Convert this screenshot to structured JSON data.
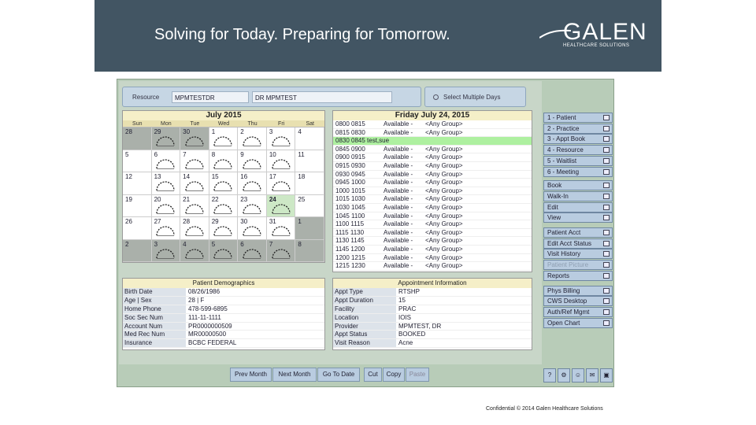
{
  "header": {
    "tagline": "Solving for Today. Preparing for Tomorrow.",
    "logo_word": "GALEN",
    "logo_sub": "HEALTHCARE SOLUTIONS"
  },
  "resource_bar": {
    "label": "Resource",
    "id_value": "MPMTESTDR",
    "name_value": "DR MPMTEST",
    "multi_days_label": "Select Multiple Days"
  },
  "calendar": {
    "title": "July 2015",
    "weekdays": [
      "Sun",
      "Mon",
      "Tue",
      "Wed",
      "Thu",
      "Fri",
      "Sat"
    ],
    "weeks": [
      [
        "28",
        "29",
        "30",
        "1",
        "2",
        "3",
        "4"
      ],
      [
        "5",
        "6",
        "7",
        "8",
        "9",
        "10",
        "11"
      ],
      [
        "12",
        "13",
        "14",
        "15",
        "16",
        "17",
        "18"
      ],
      [
        "19",
        "20",
        "21",
        "22",
        "23",
        "24",
        "25"
      ],
      [
        "26",
        "27",
        "28",
        "29",
        "30",
        "31",
        "1"
      ],
      [
        "2",
        "3",
        "4",
        "5",
        "6",
        "7",
        "8"
      ]
    ],
    "selected_day": "24"
  },
  "slots": {
    "title": "Friday July 24, 2015",
    "rows": [
      {
        "time": "0800 0815",
        "status": "Available -",
        "group": "<Any Group>",
        "selected": false
      },
      {
        "time": "0815 0830",
        "status": "Available -",
        "group": "<Any Group>",
        "selected": false
      },
      {
        "time": "0830 0845 test,sue",
        "status": "",
        "group": "",
        "selected": true
      },
      {
        "time": "0845 0900",
        "status": "Available -",
        "group": "<Any Group>",
        "selected": false
      },
      {
        "time": "0900 0915",
        "status": "Available -",
        "group": "<Any Group>",
        "selected": false
      },
      {
        "time": "0915 0930",
        "status": "Available -",
        "group": "<Any Group>",
        "selected": false
      },
      {
        "time": "0930 0945",
        "status": "Available -",
        "group": "<Any Group>",
        "selected": false
      },
      {
        "time": "0945 1000",
        "status": "Available -",
        "group": "<Any Group>",
        "selected": false
      },
      {
        "time": "1000 1015",
        "status": "Available -",
        "group": "<Any Group>",
        "selected": false
      },
      {
        "time": "1015 1030",
        "status": "Available -",
        "group": "<Any Group>",
        "selected": false
      },
      {
        "time": "1030 1045",
        "status": "Available -",
        "group": "<Any Group>",
        "selected": false
      },
      {
        "time": "1045 1100",
        "status": "Available -",
        "group": "<Any Group>",
        "selected": false
      },
      {
        "time": "1100 1115",
        "status": "Available -",
        "group": "<Any Group>",
        "selected": false
      },
      {
        "time": "1115 1130",
        "status": "Available -",
        "group": "<Any Group>",
        "selected": false
      },
      {
        "time": "1130 1145",
        "status": "Available -",
        "group": "<Any Group>",
        "selected": false
      },
      {
        "time": "1145 1200",
        "status": "Available -",
        "group": "<Any Group>",
        "selected": false
      },
      {
        "time": "1200 1215",
        "status": "Available -",
        "group": "<Any Group>",
        "selected": false
      },
      {
        "time": "1215 1230",
        "status": "Available -",
        "group": "<Any Group>",
        "selected": false
      }
    ]
  },
  "demographics": {
    "title": "Patient Demographics",
    "rows": [
      {
        "label": "Birth Date",
        "value": "08/26/1986"
      },
      {
        "label": "Age | Sex",
        "value": "28 | F"
      },
      {
        "label": "Home Phone",
        "value": "478-599-6895"
      },
      {
        "label": "Soc Sec Num",
        "value": "111-11-1111"
      },
      {
        "label": "Account Num",
        "value": "PR0000000509"
      },
      {
        "label": "Med Rec Num",
        "value": "MR00000500"
      },
      {
        "label": "Insurance",
        "value": "BCBC FEDERAL"
      }
    ]
  },
  "appointment": {
    "title": "Appointment Information",
    "rows": [
      {
        "label": "Appt Type",
        "value": "RTSHP"
      },
      {
        "label": "Appt Duration",
        "value": "15"
      },
      {
        "label": "Facility",
        "value": "PRAC"
      },
      {
        "label": "Location",
        "value": "IOIS"
      },
      {
        "label": "Provider",
        "value": "MPMTEST, DR"
      },
      {
        "label": "Appt Status",
        "value": "BOOKED"
      },
      {
        "label": "Visit Reason",
        "value": "Acne"
      }
    ]
  },
  "toolbar": {
    "prev_month": "Prev Month",
    "next_month": "Next Month",
    "go_to_date": "Go To Date",
    "cut": "Cut",
    "copy": "Copy",
    "paste": "Paste"
  },
  "nav": {
    "tabs": [
      {
        "label": "1 - Patient",
        "icon": "patient-icon"
      },
      {
        "label": "2 - Practice",
        "icon": "practice-icon"
      },
      {
        "label": "3 - Appt Book",
        "icon": "book-icon"
      },
      {
        "label": "4 - Resource",
        "icon": "resource-icon"
      },
      {
        "label": "5 - Waitlist",
        "icon": "waitlist-icon"
      },
      {
        "label": "6 - Meeting",
        "icon": "meeting-icon"
      }
    ],
    "appt_actions": [
      {
        "label": "Book",
        "icon": "book-icon"
      },
      {
        "label": "Walk-In",
        "icon": "walk-in-icon"
      },
      {
        "label": "Edit",
        "icon": "edit-icon"
      },
      {
        "label": "View",
        "icon": "view-icon"
      }
    ],
    "patient_actions": [
      {
        "label": "Patient Acct",
        "icon": "account-icon",
        "enabled": true
      },
      {
        "label": "Edit Acct Status",
        "icon": "status-icon",
        "enabled": true
      },
      {
        "label": "Visit History",
        "icon": "history-icon",
        "enabled": true
      },
      {
        "label": "Patient Picture",
        "icon": "picture-icon",
        "enabled": false
      },
      {
        "label": "Reports",
        "icon": "reports-icon",
        "enabled": true
      }
    ],
    "billing_actions": [
      {
        "label": "Phys Billing",
        "icon": "billing-icon"
      },
      {
        "label": "CWS Desktop",
        "icon": "desktop-icon"
      },
      {
        "label": "Auth/Ref Mgmt",
        "icon": "auth-icon"
      },
      {
        "label": "Open Chart",
        "icon": "chart-icon"
      }
    ],
    "bottom_buttons": [
      "?",
      "⚙",
      "☺",
      "✉",
      "▣"
    ]
  },
  "footer": {
    "text": "Confidential © 2014 Galen Healthcare Solutions"
  }
}
